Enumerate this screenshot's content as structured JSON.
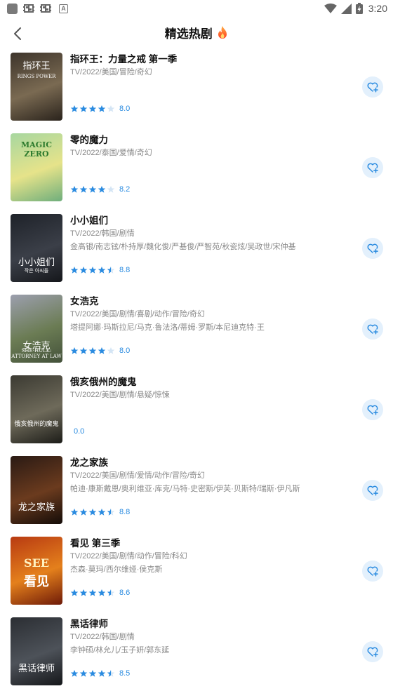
{
  "status_bar": {
    "time": "3:20",
    "left_icons": [
      "app-square-icon",
      "bug-icon",
      "bug-icon",
      "a-icon"
    ],
    "right_icons": [
      "wifi-icon",
      "signal-icon",
      "battery-charging-icon"
    ]
  },
  "header": {
    "title": "精选热剧",
    "title_icon": "fire-icon",
    "back_icon": "chevron-left-icon"
  },
  "colors": {
    "accent": "#2a8be0",
    "star_filled": "#2a8be0",
    "star_empty": "#d4e5f5",
    "fav_bg": "#e3f0fc",
    "muted_text": "#888888"
  },
  "items": [
    {
      "title": "指环王：力量之戒 第一季",
      "meta": "TV/2022/美国/冒险/奇幻",
      "cast": "",
      "rating": 4,
      "score": "8.0",
      "poster_text": "指环王",
      "poster_subtext": "RINGS POWER",
      "poster_colors": [
        "#3d342b",
        "#7a6a52",
        "#2a231c"
      ]
    },
    {
      "title": "零的魔力",
      "meta": "TV/2022/泰国/爱情/奇幻",
      "cast": "",
      "rating": 4,
      "score": "8.2",
      "poster_text": "MAGIC ZERO",
      "poster_subtext": "",
      "poster_colors": [
        "#a7d7a0",
        "#e6e38a",
        "#6fae7c"
      ]
    },
    {
      "title": "小小姐们",
      "meta": "TV/2022/韩国/剧情",
      "cast": "金高银/南志铉/朴持厚/魏化俊/严基俊/严智苑/秋瓷炫/吴政世/宋仲基",
      "rating": 4.5,
      "score": "8.8",
      "poster_text": "小小姐们",
      "poster_subtext": "작은 아씨들",
      "poster_colors": [
        "#1e2229",
        "#3b3f48",
        "#15171b"
      ]
    },
    {
      "title": "女浩克",
      "meta": "TV/2022/美国/剧情/喜剧/动作/冒险/奇幻",
      "cast": "塔提阿娜·玛斯拉尼/马克·鲁法洛/蒂姆·罗斯/本尼迪克特·王",
      "rating": 4,
      "score": "8.0",
      "poster_text": "女浩克",
      "poster_subtext": "SHE-HULK: ATTORNEY AT LAW",
      "poster_colors": [
        "#9c9fae",
        "#6b7c54",
        "#43513a"
      ]
    },
    {
      "title": "俄亥俄州的魔鬼",
      "meta": "TV/2022/美国/剧情/悬疑/惊悚",
      "cast": "",
      "rating": 0,
      "score": "0.0",
      "poster_text": "俄亥俄州的魔鬼",
      "poster_subtext": "",
      "poster_colors": [
        "#3b3a32",
        "#6e6a5a",
        "#1c1c18"
      ]
    },
    {
      "title": "龙之家族",
      "meta": "TV/2022/美国/剧情/爱情/动作/冒险/奇幻",
      "cast": "帕迪·康斯戴恩/奥利维亚·库克/马特·史密斯/伊芙·贝斯特/瑞斯·伊凡斯",
      "rating": 4.5,
      "score": "8.8",
      "poster_text": "龙之家族",
      "poster_subtext": "",
      "poster_colors": [
        "#2a1a14",
        "#6b3b1e",
        "#140c08"
      ]
    },
    {
      "title": "看见 第三季",
      "meta": "TV/2022/美国/剧情/动作/冒险/科幻",
      "cast": "杰森·莫玛/西尔维娅·侯克斯",
      "rating": 4.5,
      "score": "8.6",
      "poster_text": "看见",
      "poster_subtext": "SEE",
      "poster_colors": [
        "#b83a12",
        "#e4801c",
        "#6e1a08"
      ]
    },
    {
      "title": "黑话律师",
      "meta": "TV/2022/韩国/剧情",
      "cast": "李钟硕/林允儿/玉子妍/郭东延",
      "rating": 4.5,
      "score": "8.5",
      "poster_text": "黑话律师",
      "poster_subtext": "",
      "poster_colors": [
        "#2b2e33",
        "#4d5259",
        "#15171a"
      ]
    }
  ]
}
